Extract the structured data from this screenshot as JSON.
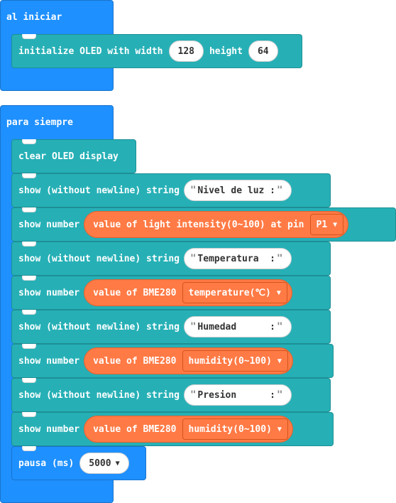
{
  "on_start": {
    "label": "al iniciar",
    "init": {
      "text1": "initialize OLED with width",
      "width": "128",
      "text2": "height",
      "height": "64"
    }
  },
  "forever": {
    "label": "para siempre",
    "clear": "clear OLED display",
    "show_string_label": "show (without newline) string",
    "show_number_label": "show number",
    "strings": [
      "Nivel de luz :",
      "Temperatura  :",
      "Humedad      :",
      "Presion      :"
    ],
    "light": {
      "label": "value of light intensity(0~100) at pin",
      "pin": "P1"
    },
    "bme_label": "value of BME280",
    "bme_options": [
      "temperature(℃)",
      "humidity(0~100)",
      "humidity(0~100)"
    ],
    "pause": {
      "label": "pausa (ms)",
      "value": "5000"
    }
  },
  "icons": {
    "dropdown": "caret-down-icon"
  }
}
